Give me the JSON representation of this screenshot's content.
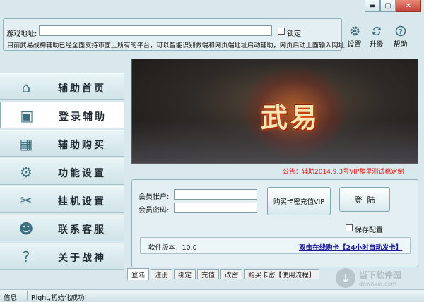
{
  "window": {
    "controls": [
      "▬",
      "▢",
      "✕"
    ]
  },
  "address": {
    "label": "游戏地址:",
    "value": "",
    "lock_label": "锁定",
    "notice": "目前武易战神辅助已经全面支持市面上所有的平台，可以智能识别微端和网页端地址启动辅助，网页启动上面输入网址"
  },
  "tools": {
    "settings": {
      "icon": "gear-icon",
      "label": "设置"
    },
    "upgrade": {
      "icon": "refresh-icon",
      "label": "升级"
    },
    "help": {
      "icon": "help-icon",
      "label": "帮助"
    }
  },
  "menu": [
    {
      "key": "home",
      "icon": "house-icon",
      "glyph": "⌂",
      "label": "辅助首页",
      "active": false
    },
    {
      "key": "login",
      "icon": "monitor-icon",
      "glyph": "▣",
      "label": "登录辅助",
      "active": true
    },
    {
      "key": "buy",
      "icon": "chart-icon",
      "glyph": "▦",
      "label": "辅助购买",
      "active": false
    },
    {
      "key": "settings",
      "icon": "gear-icon",
      "glyph": "⚙",
      "label": "功能设置",
      "active": false
    },
    {
      "key": "hangup",
      "icon": "tools-icon",
      "glyph": "✂",
      "label": "挂机设置",
      "active": false
    },
    {
      "key": "contact",
      "icon": "person-icon",
      "glyph": "☻",
      "label": "联系客服",
      "active": false
    },
    {
      "key": "about",
      "icon": "question-icon",
      "glyph": "?",
      "label": "关于战神",
      "active": false
    }
  ],
  "banner": {
    "logo": "武易"
  },
  "announcement": "公告：辅助2014.9.3号VIP群里测试稳定倒",
  "login": {
    "account_label": "会员帐户:",
    "account_value": "",
    "password_label": "会员密码:",
    "password_value": "",
    "buy_button": "购买卡密充值VIP",
    "login_button": "登  陆",
    "save_label": "保存配置",
    "version_label": "软件版本：10.0",
    "buy_link": "双击在线购卡【24小时自动发卡】"
  },
  "tabs": [
    "登陆",
    "注册",
    "绑定",
    "充值",
    "改密",
    "购买卡密【使用流程】"
  ],
  "status": {
    "left": "信息",
    "message": "Right,初始化成功!"
  },
  "watermark": {
    "line1": "当下软件园",
    "line2": "downxia.com"
  },
  "colors": {
    "accent": "#3d6e7e",
    "announcement": "#e31b1b",
    "link": "#1b1b9e"
  }
}
